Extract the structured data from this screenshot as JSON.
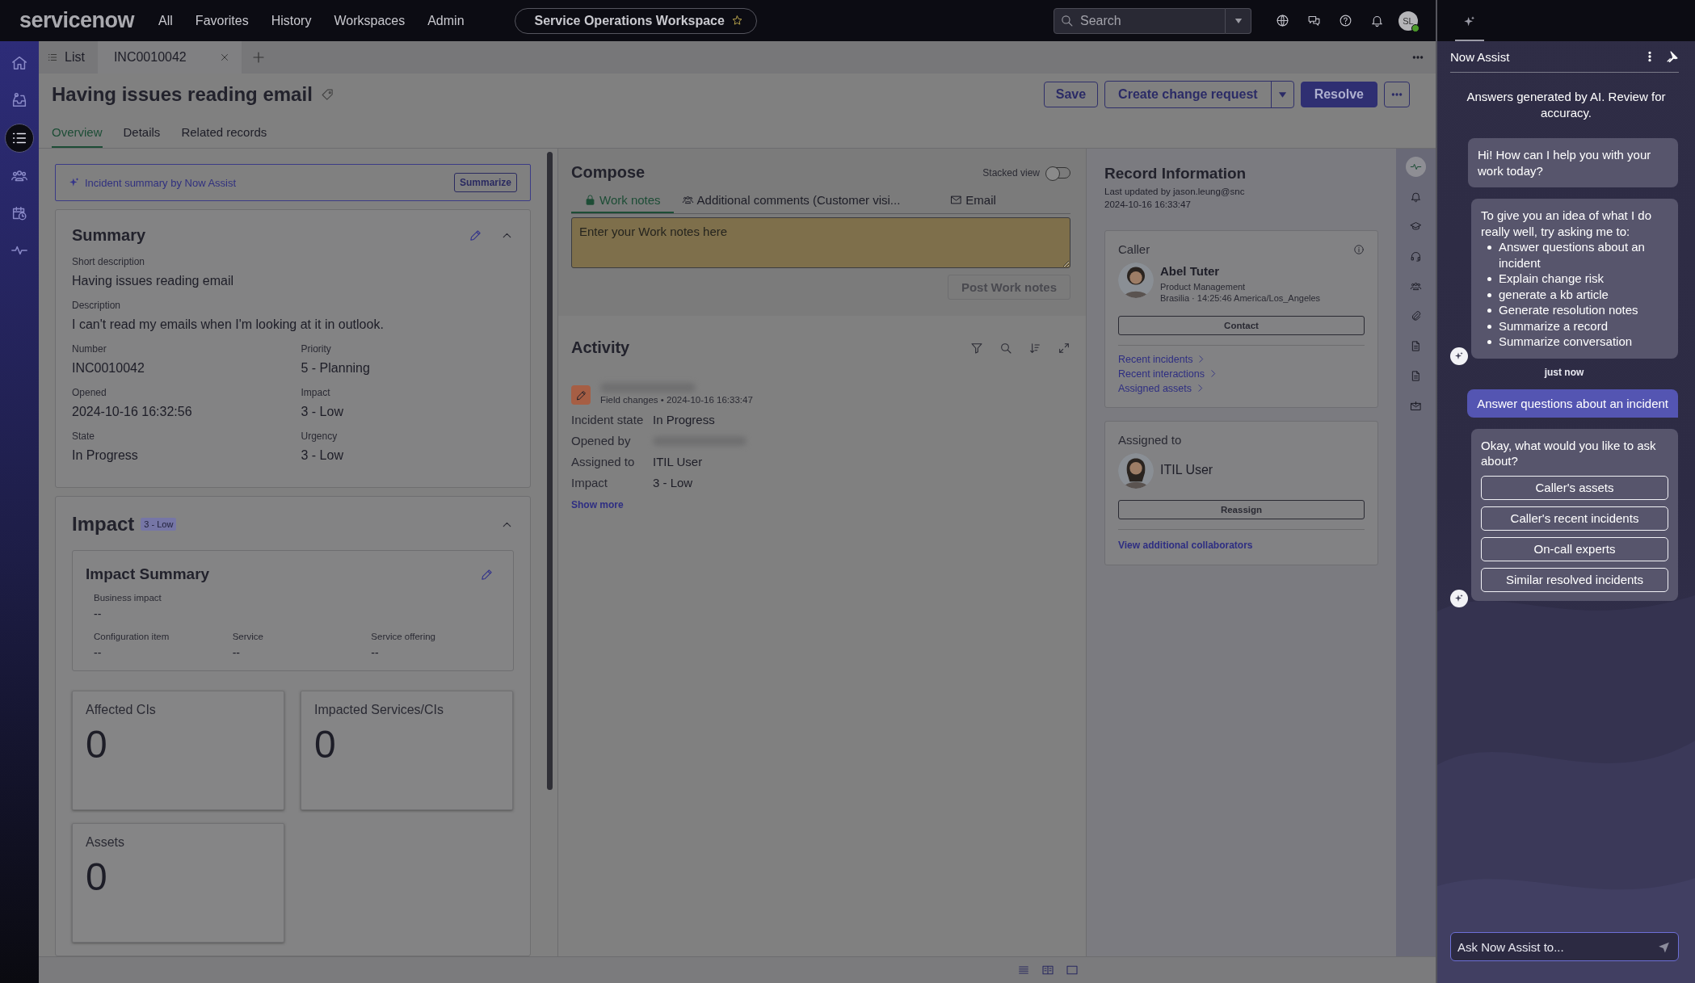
{
  "top_nav": {
    "logo": "servicenow",
    "menu": [
      "All",
      "Favorites",
      "History",
      "Workspaces",
      "Admin"
    ],
    "workspace": "Service Operations Workspace",
    "search": {
      "placeholder": "Search"
    },
    "avatar": "SL"
  },
  "left_rail": [
    {
      "kind": "home",
      "selected": false
    },
    {
      "kind": "inbox",
      "selected": false
    },
    {
      "kind": "list",
      "selected": true
    },
    {
      "kind": "team",
      "selected": false
    },
    {
      "kind": "calendar",
      "selected": false
    },
    {
      "kind": "pulse",
      "selected": false
    }
  ],
  "tabs": [
    {
      "label": "List",
      "kind": "list",
      "selected": false
    },
    {
      "label": "INC0010042",
      "kind": "record",
      "selected": true
    }
  ],
  "record": {
    "title": "Having issues reading email",
    "tabs": [
      {
        "label": "Overview",
        "selected": true
      },
      {
        "label": "Details",
        "selected": false
      },
      {
        "label": "Related records",
        "selected": false
      }
    ],
    "buttons": [
      {
        "label": "Save",
        "kind": "outline"
      },
      {
        "label": "Create change request",
        "kind": "split"
      },
      {
        "label": "Resolve",
        "kind": "primary"
      },
      {
        "kind": "more"
      }
    ]
  },
  "summary_banner": {
    "text": "Incident summary by Now Assist",
    "button": "Summarize"
  },
  "summary": {
    "title": "Summary",
    "fields": [
      {
        "label": "Short description",
        "value": "Having issues reading email",
        "kind": "wide"
      },
      {
        "label": "Description",
        "value": "I can't read my emails when I'm looking at it in outlook.",
        "kind": "wide"
      },
      {
        "label": "Number",
        "value": "INC0010042",
        "kind": "half"
      },
      {
        "label": "Priority",
        "value": "5 - Planning",
        "kind": "half"
      },
      {
        "label": "Opened",
        "value": "2024-10-16 16:32:56",
        "kind": "half"
      },
      {
        "label": "Impact",
        "value": "3 - Low",
        "kind": "half"
      },
      {
        "label": "State",
        "value": "In Progress",
        "kind": "half"
      },
      {
        "label": "Urgency",
        "value": "3 - Low",
        "kind": "half"
      }
    ]
  },
  "impact": {
    "title": "Impact",
    "badge": "3 - Low",
    "summary": {
      "title": "Impact Summary",
      "fields": [
        {
          "label": "Business impact",
          "value": "--",
          "kind": "wide"
        },
        {
          "label": "Configuration item",
          "value": "--",
          "kind": "third"
        },
        {
          "label": "Service",
          "value": "--",
          "kind": "third"
        },
        {
          "label": "Service offering",
          "value": "--",
          "kind": "third"
        }
      ]
    },
    "counters": [
      {
        "label": "Affected CIs",
        "value": "0"
      },
      {
        "label": "Impacted Services/CIs",
        "value": "0"
      },
      {
        "label": "Assets",
        "value": "0"
      }
    ]
  },
  "compose": {
    "title": "Compose",
    "stacked_view": {
      "label": "Stacked view",
      "on": false
    },
    "tabs": [
      {
        "label": "Work notes",
        "kind": "lock",
        "selected": true
      },
      {
        "label": "Additional comments (Customer visi...",
        "kind": "people",
        "selected": false
      },
      {
        "label": "Email",
        "kind": "mail",
        "selected": false
      }
    ],
    "placeholder": "Enter your Work notes here",
    "post_button": {
      "label": "Post Work notes",
      "disabled": true
    }
  },
  "activity": {
    "title": "Activity",
    "entry": {
      "meta": "Field changes • 2024-10-16 16:33:47",
      "changes": [
        {
          "label": "Incident state",
          "value": "In Progress",
          "kind": "text"
        },
        {
          "label": "Opened by",
          "kind": "redacted"
        },
        {
          "label": "Assigned to",
          "value": "ITIL User",
          "kind": "text"
        },
        {
          "label": "Impact",
          "value": "3 - Low",
          "kind": "text"
        }
      ]
    },
    "show_more": "Show more"
  },
  "record_info": {
    "title": "Record Information",
    "updated_by": "Last updated by jason.leung@snc",
    "updated_at": "2024-10-16 16:33:47",
    "caller": {
      "title": "Caller",
      "name": "Abel Tuter",
      "department": "Product Management",
      "location": "Brasilia · 14:25:46 America/Los_Angeles",
      "button": "Contact",
      "links": [
        "Recent incidents",
        "Recent interactions",
        "Assigned assets"
      ]
    },
    "assigned": {
      "title": "Assigned to",
      "name": "ITIL User",
      "button": "Reassign",
      "link": "View additional collaborators"
    }
  },
  "side_rail": [
    {
      "kind": "pulse",
      "selected": true
    },
    {
      "kind": "bell",
      "selected": false
    },
    {
      "kind": "cap",
      "selected": false
    },
    {
      "kind": "headset",
      "selected": false
    },
    {
      "kind": "team",
      "selected": false
    },
    {
      "kind": "clip",
      "selected": false
    },
    {
      "kind": "doc",
      "selected": false
    },
    {
      "kind": "doc",
      "selected": false
    },
    {
      "kind": "mailplus",
      "selected": false
    }
  ],
  "now_assist": {
    "title": "Now Assist",
    "disclaimer": "Answers generated by AI. Review for accuracy.",
    "messages": [
      {
        "kind": "bot",
        "text": "Hi! How can I help you with your work today?",
        "show_avatar": false
      },
      {
        "kind": "bot_list",
        "text": "To give you an idea of what I do really well, try asking me to:",
        "items": [
          "Answer questions about an incident",
          "Explain change risk",
          "generate a kb article",
          "Generate resolution notes",
          "Summarize a record",
          "Summarize conversation"
        ],
        "show_avatar": true
      },
      {
        "kind": "time",
        "text": "just now"
      },
      {
        "kind": "user",
        "text": "Answer questions about an incident"
      },
      {
        "kind": "bot_options",
        "text": "Okay, what would you like to ask about?",
        "options": [
          "Caller's assets",
          "Caller's recent incidents",
          "On-call experts",
          "Similar resolved incidents"
        ],
        "show_avatar": true
      }
    ],
    "input": {
      "placeholder": "Ask Now Assist to..."
    }
  }
}
